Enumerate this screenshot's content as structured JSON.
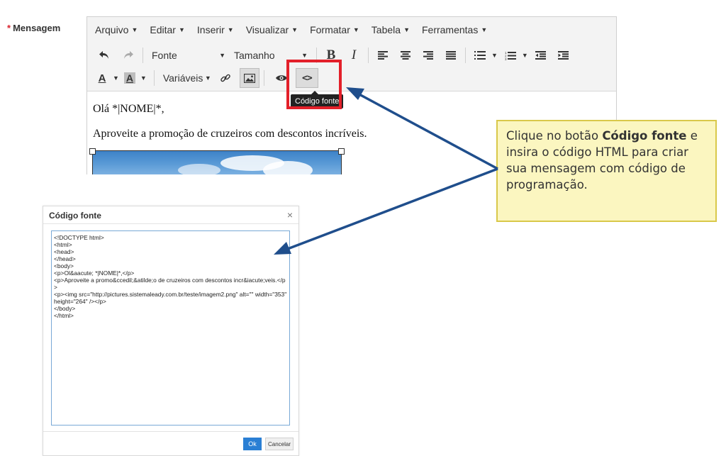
{
  "field": {
    "required_mark": "*",
    "label": "Mensagem"
  },
  "menubar": [
    "Arquivo",
    "Editar",
    "Inserir",
    "Visualizar",
    "Formatar",
    "Tabela",
    "Ferramentas"
  ],
  "toolbar": {
    "font_select": "Fonte",
    "size_select": "Tamanho",
    "bold": "B",
    "italic": "I",
    "text_color": "A",
    "bg_color": "A",
    "variables": "Variáveis",
    "source_code_glyph": "<>"
  },
  "tooltip": "Código fonte",
  "content": {
    "line1": "Olá *|NOME|*,",
    "line2": "Aproveite a promoção de cruzeiros com descontos incríveis."
  },
  "callout": {
    "prefix": "Clique no botão ",
    "bold": "Código fonte",
    "suffix": " e insira o código HTML para criar sua mensagem com código de programação."
  },
  "dialog": {
    "title": "Código fonte",
    "close": "×",
    "code": "<!DOCTYPE html>\n<html>\n<head>\n</head>\n<body>\n<p>Ol&aacute; *|NOME|*,</p>\n<p>Aproveite a promo&ccedil;&atilde;o de cruzeiros com descontos incr&iacute;veis.</p>\n<p><img src=\"http://pictures.sistemaleady.com.br/teste/imagem2.png\" alt=\"\" width=\"353\" height=\"264\" /></p>\n</body>\n</html>",
    "ok": "Ok",
    "cancel": "Cancelar"
  },
  "colors": {
    "accent": "#2a7fd4",
    "highlight": "#e3202a",
    "callout_bg": "#fbf6c0",
    "arrow": "#1f4e8c"
  },
  "icons": [
    "undo-icon",
    "redo-icon",
    "align-left-icon",
    "align-center-icon",
    "align-right-icon",
    "align-justify-icon",
    "bullet-list-icon",
    "numbered-list-icon",
    "outdent-icon",
    "indent-icon",
    "link-icon",
    "image-icon",
    "preview-eye-icon",
    "source-code-icon"
  ]
}
